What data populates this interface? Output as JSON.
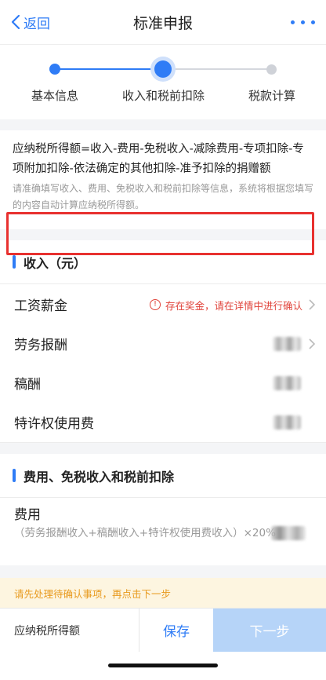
{
  "header": {
    "back_label": "返回",
    "title": "标准申报"
  },
  "steps": [
    {
      "label": "基本信息",
      "state": "done"
    },
    {
      "label": "收入和税前扣除",
      "state": "current"
    },
    {
      "label": "税款计算",
      "state": "pending"
    }
  ],
  "formula": {
    "text": "应纳税所得额=收入-费用-免税收入-减除费用-专项扣除-专项附加扣除-依法确定的其他扣除-准予扣除的捐赠额",
    "hint": "请准确填写收入、费用、免税收入和税前扣除等信息，系统将根据您填写的内容自动计算应纳税所得额。"
  },
  "income": {
    "title": "收入（元）",
    "rows": [
      {
        "label": "工资薪金",
        "warning": "存在奖金，请在详情中进行确认"
      },
      {
        "label": "劳务报酬"
      },
      {
        "label": "稿酬"
      },
      {
        "label": "特许权使用费"
      }
    ]
  },
  "deductions": {
    "title": "费用、免税收入和税前扣除",
    "expense_label": "费用",
    "expense_desc": "（劳务报酬收入+稿酬收入+特许权使用费收入）×20%"
  },
  "notice": "请先处理待确认事项，再点击下一步",
  "bottom": {
    "label": "应纳税所得额",
    "save": "保存",
    "next": "下一步"
  },
  "colors": {
    "accent": "#2f7cf6",
    "warning": "#e0433a",
    "notice_text": "#e89a1e",
    "notice_bg": "#fdf5e0",
    "next_disabled": "#b6d4f8"
  }
}
